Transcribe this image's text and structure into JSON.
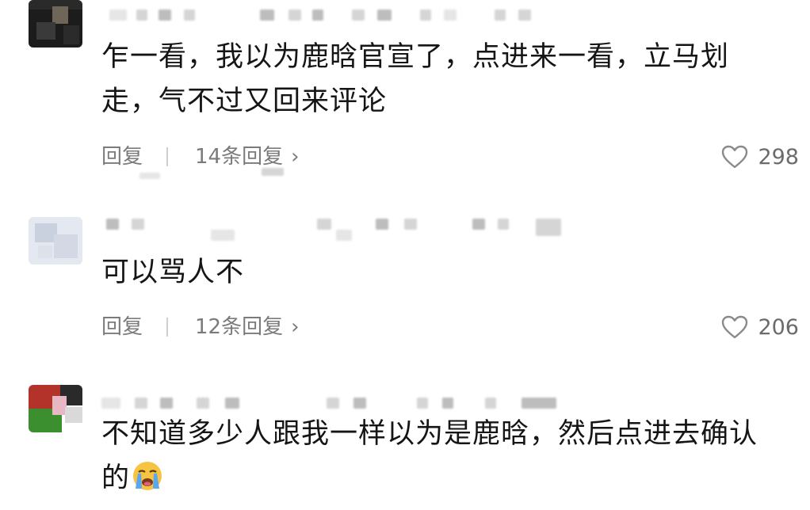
{
  "comments": [
    {
      "text": "乍一看，我以为鹿晗官宣了，点进来一看，立马划走，气不过又回来评论",
      "reply_label": "回复",
      "replies_count_label": "14条回复",
      "likes": "298",
      "avatar_colors": [
        "#1c1c1c",
        "#6e6658"
      ]
    },
    {
      "text": "可以骂人不",
      "reply_label": "回复",
      "replies_count_label": "12条回复",
      "likes": "206",
      "avatar_colors": [
        "#e4e8f0",
        "#c9d0de"
      ]
    },
    {
      "text": "不知道多少人跟我一样以为是鹿晗，然后点进去确认的",
      "emoji": "loudly-crying-face",
      "avatar_colors": [
        "#3c8f2e",
        "#b3332a",
        "#e8b7c4"
      ]
    }
  ],
  "icons": {
    "like": "heart-outline-icon",
    "chevron": "chevron-right-icon"
  },
  "colors": {
    "text": "#151515",
    "meta": "#7b7b7b",
    "like_count": "#6b6b6b",
    "background": "#ffffff"
  }
}
